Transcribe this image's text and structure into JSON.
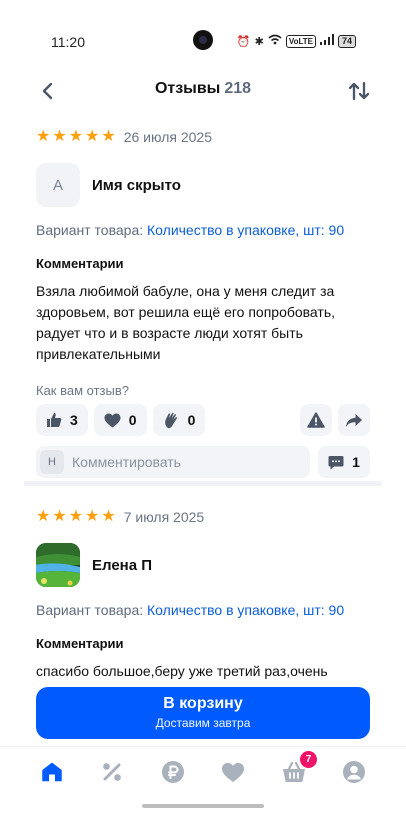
{
  "status_bar": {
    "time": "11:20",
    "network_label": "VoLTE",
    "battery": "74"
  },
  "header": {
    "title": "Отзывы",
    "count": "218"
  },
  "reviews": [
    {
      "stars": 5,
      "date": "26 июля 2025",
      "avatar_letter": "А",
      "author": "Имя скрыто",
      "variant_label": "Вариант товара:",
      "variant_value": "Количество в упаковке, шт: 90",
      "comment_title": "Комментарии",
      "text": "Взяла любимой бабуле, она у меня следит за здоровьем, вот решила ещё его попробовать, радует что и в возрасте люди хотят быть привлекательными",
      "question": "Как вам отзыв?",
      "likes": "3",
      "hearts": "0",
      "claps": "0",
      "comment_avatar": "Н",
      "comment_placeholder": "Комментировать",
      "comments_count": "1"
    },
    {
      "stars": 5,
      "date": "7 июля 2025",
      "author": "Елена П",
      "variant_label": "Вариант товара:",
      "variant_value": "Количество в упаковке, шт: 90",
      "comment_title": "Комментарии",
      "text": "спасибо большое,беру уже третий раз,очень"
    }
  ],
  "cart": {
    "label": "В корзину",
    "sublabel": "Доставим завтра"
  },
  "nav": {
    "cart_badge": "7"
  },
  "colors": {
    "accent": "#005bff",
    "star": "#ff9f0a",
    "badge": "#f0136a",
    "link": "#0b5ed7"
  }
}
